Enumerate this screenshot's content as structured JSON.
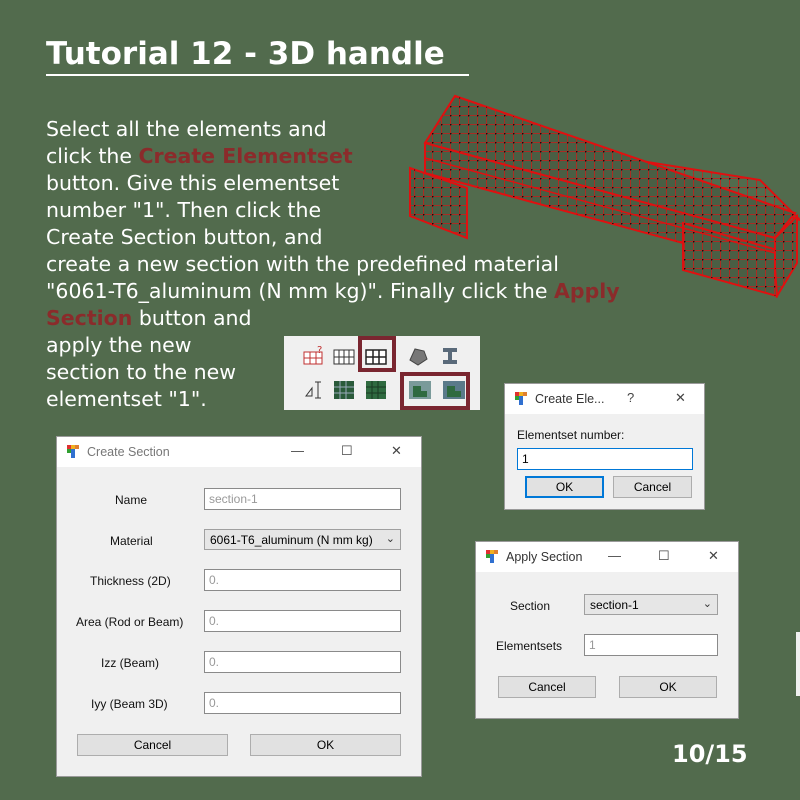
{
  "slide": {
    "title": "Tutorial 12 - 3D handle",
    "page": "10/15"
  },
  "instructions": {
    "l1": "Select all the elements and",
    "l2a": "click the ",
    "l2b": "Create Elementset",
    "l3": "button. Give this elementset",
    "l4": "number \"1\". Then click the",
    "l5": "Create Section button, and",
    "l6": "create a new section with the predefined material",
    "l7a": "\"6061-T6_aluminum (N mm kg)\". Finally click the ",
    "l7b": "Apply",
    "l8a": "Section",
    "l8b": " button and",
    "l9": "apply the new",
    "l10": "section to the new",
    "l11": "elementset \"1\".",
    "highlight_color": "#8b2b2b"
  },
  "toolbar": {
    "buttons": [
      "create-node-icon",
      "mesh-grid-icon",
      "create-elementset-icon",
      "material-icon",
      "section-beam-icon",
      "measure-icon",
      "mesh-dark-icon",
      "mesh-green-icon",
      "create-section-icon",
      "apply-section-icon"
    ],
    "highlight_color": "#7a2630"
  },
  "create_section": {
    "title": "Create Section",
    "fields": {
      "name_label": "Name",
      "name_value": "section-1",
      "material_label": "Material",
      "material_value": "6061-T6_aluminum (N mm kg)",
      "thickness_label": "Thickness (2D)",
      "thickness_value": "0.",
      "area_label": "Area (Rod or Beam)",
      "area_value": "0.",
      "izz_label": "Izz (Beam)",
      "izz_value": "0.",
      "iyy_label": "Iyy (Beam 3D)",
      "iyy_value": "0."
    },
    "cancel": "Cancel",
    "ok": "OK"
  },
  "create_elementset": {
    "title": "Create Ele...",
    "help": "?",
    "label": "Elementset number:",
    "value": "1",
    "ok": "OK",
    "cancel": "Cancel"
  },
  "apply_section": {
    "title": "Apply Section",
    "section_label": "Section",
    "section_value": "section-1",
    "elementsets_label": "Elementsets",
    "elementsets_value": "1",
    "cancel": "Cancel",
    "ok": "OK"
  },
  "window_controls": {
    "minimize": "—",
    "maximize": "☐",
    "close": "✕"
  },
  "colors": {
    "background": "#526b4d",
    "mesh_red": "#e01010",
    "mesh_fill": "#4a5e44"
  }
}
